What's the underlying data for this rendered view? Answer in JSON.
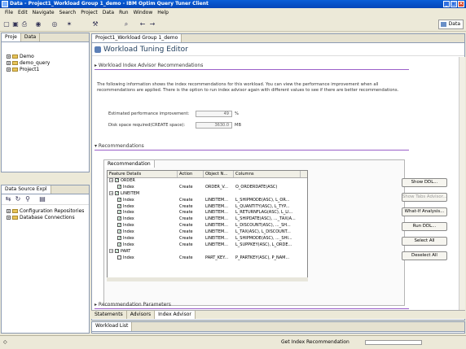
{
  "window": {
    "title": "Data - Project1_Workload Group 1_demo - IBM Optim Query Tuner Client"
  },
  "menu": [
    "File",
    "Edit",
    "Navigate",
    "Search",
    "Project",
    "Data",
    "Run",
    "Window",
    "Help"
  ],
  "perspective": "Data",
  "left_top": {
    "tabs": [
      "Proje",
      "Data"
    ],
    "tree": [
      "Demo",
      "demo_query",
      "Project1"
    ]
  },
  "left_bottom": {
    "tabs": [
      "Data Source Expl"
    ],
    "tree": [
      "Configuration Repositories",
      "Database Connections"
    ]
  },
  "editor": {
    "tab": "Project1_Workload Group 1_demo",
    "header": "Workload Tuning Editor",
    "section_top": "Workload Index Advisor Recommendations",
    "description": "The following information shows the index recommendations for this workload. You can view the performance improvement when all recommendations are applied. There is the option to run index advisor again with different values to see if there are better recommendations.",
    "fields": [
      {
        "label": "Estimated performance improvement:",
        "value": "49",
        "unit": "%"
      },
      {
        "label": "Disk space required(CREATE space):",
        "value": "3630.0",
        "unit": "MB"
      }
    ],
    "section_recs": "Recommendations",
    "inner_tab": "Recommendation",
    "table": {
      "columns": [
        "Feature Details",
        "Action",
        "Object N...",
        "Columns"
      ],
      "rows": [
        {
          "indent": 0,
          "twisty": "−",
          "check": "✓",
          "details": "ORDER",
          "action": "",
          "object": "",
          "columns": ""
        },
        {
          "indent": 1,
          "twisty": "",
          "check": "✓",
          "details": "Index",
          "action": "Create",
          "object": "ORDER_V...",
          "columns": "O_ORDERDATE(ASC)"
        },
        {
          "indent": 0,
          "twisty": "−",
          "check": "✓",
          "details": "LINEITEM",
          "action": "",
          "object": "",
          "columns": ""
        },
        {
          "indent": 1,
          "twisty": "",
          "check": "✓",
          "details": "Index",
          "action": "Create",
          "object": "LINEITEM...",
          "columns": "L_SHIPMODE(ASC), L_OR..."
        },
        {
          "indent": 1,
          "twisty": "",
          "check": "✓",
          "details": "Index",
          "action": "Create",
          "object": "LINEITEM...",
          "columns": "L_QUANTITY(ASC), L_TYP..."
        },
        {
          "indent": 1,
          "twisty": "",
          "check": "✓",
          "details": "Index",
          "action": "Create",
          "object": "LINEITEM...",
          "columns": "L_RETURNFLAG(ASC), L_LI..."
        },
        {
          "indent": 1,
          "twisty": "",
          "check": "✓",
          "details": "Index",
          "action": "Create",
          "object": "LINEITEM...",
          "columns": "L_SHIPDATE(ASC), ..._TAX(A..."
        },
        {
          "indent": 1,
          "twisty": "",
          "check": "✓",
          "details": "Index",
          "action": "Create",
          "object": "LINEITEM...",
          "columns": "L_DISCOUNT(ASC), ..._SH..."
        },
        {
          "indent": 1,
          "twisty": "",
          "check": "✓",
          "details": "Index",
          "action": "Create",
          "object": "LINEITEM...",
          "columns": "L_TAX(ASC), L_DISCOUNT..."
        },
        {
          "indent": 1,
          "twisty": "",
          "check": "✓",
          "details": "Index",
          "action": "Create",
          "object": "LINEITEM...",
          "columns": "L_SHIPMODE(ASC), ..._SHI..."
        },
        {
          "indent": 1,
          "twisty": "",
          "check": "✓",
          "details": "Index",
          "action": "Create",
          "object": "LINEITEM...",
          "columns": "L_SUPPKEY(ASC), L_ORDE..."
        },
        {
          "indent": 0,
          "twisty": "−",
          "check": "✓",
          "details": "PART",
          "action": "",
          "object": "",
          "columns": ""
        },
        {
          "indent": 1,
          "twisty": "",
          "check": "",
          "details": "Index",
          "action": "Create",
          "object": "PART_KEY...",
          "columns": "P_PARTKEY(ASC), P_NAM..."
        }
      ]
    },
    "buttons": [
      "Show DDL...",
      "Show Tabs Advisor...",
      "What-If Analysis...",
      "Run DDL...",
      "Select All",
      "Deselect All"
    ],
    "section_bottom": "Recommendation Parameters",
    "bottom_tabs": [
      "Statements",
      "Advisors",
      "Index Advisor"
    ]
  },
  "bottom_view": {
    "tab": "Workload List"
  },
  "status": {
    "text": "Get Index Recommendation"
  }
}
